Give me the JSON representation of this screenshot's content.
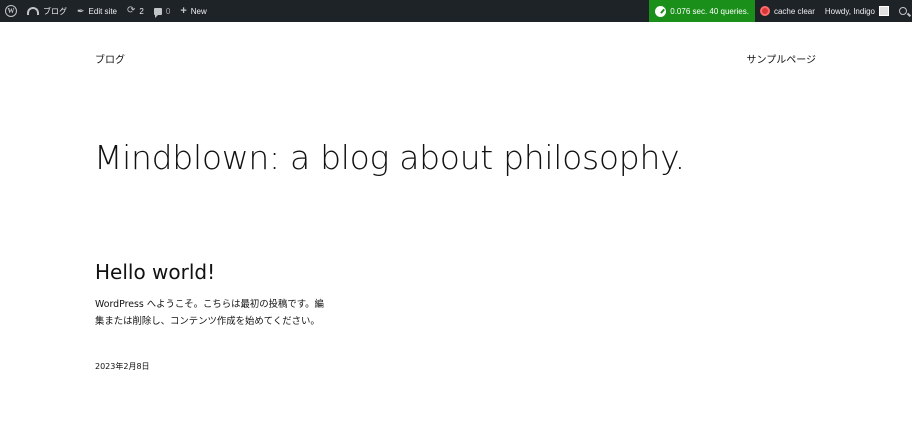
{
  "adminbar": {
    "wp_logo_icon": "wordpress-logo-icon",
    "site_name": "ブログ",
    "edit_site": "Edit site",
    "updates_count": "2",
    "comments_count": "0",
    "new_label": "New",
    "queries": "0.076 sec. 40 queries.",
    "cache_clear": "cache clear",
    "howdy": "Howdy, Indigo",
    "colors": {
      "background": "#1d2327",
      "queries_bg": "#1a8f1a",
      "cache_icon": "#d63638"
    }
  },
  "header": {
    "site_title": "ブログ",
    "nav_item": "サンプルページ"
  },
  "hero": {
    "tagline": "Mindblown: a blog about philosophy."
  },
  "post": {
    "title": "Hello world!",
    "excerpt": "WordPress へようこそ。こちらは最初の投稿です。編集または削除し、コンテンツ作成を始めてください。",
    "date": "2023年2月8日"
  }
}
